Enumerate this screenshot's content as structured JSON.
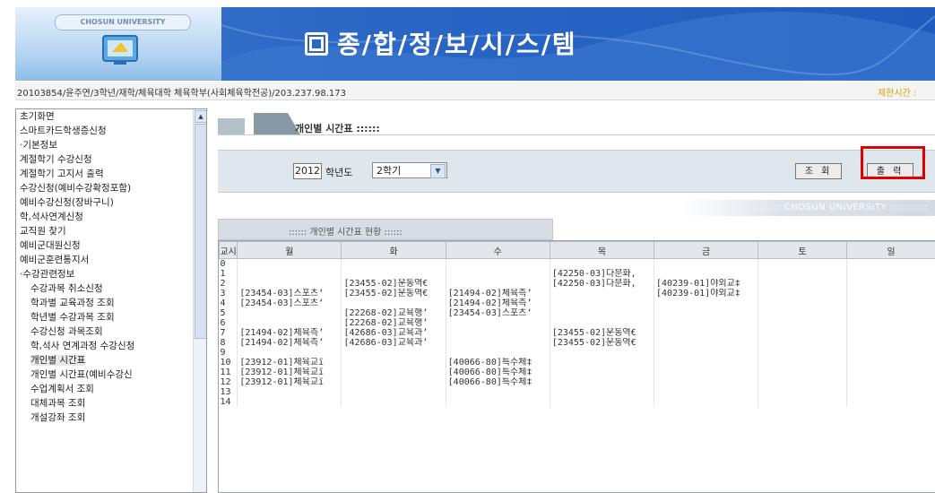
{
  "banner": {
    "university_badge": "CHOSUN UNIVERSITY",
    "system_title": "종/합/정/보/시/스/템",
    "brand_color": "#2a66c4"
  },
  "infobar": {
    "user_info": "20103854/윤주연/3학년/재학/체육대학 체육학부(사회체육학전공)/203.237.98.173",
    "right_text": "제한시간 :"
  },
  "sidebar": {
    "items": [
      {
        "label": "초기화면",
        "level": 0
      },
      {
        "label": "스마트카드학생증신청",
        "level": 0
      },
      {
        "label": "·기본정보",
        "level": 0
      },
      {
        "label": "계절학기 수강신청",
        "level": 0
      },
      {
        "label": "계절학기 고지서 출력",
        "level": 0
      },
      {
        "label": "수강신청(예비수강확정포함)",
        "level": 0
      },
      {
        "label": "예비수강신청(장바구니)",
        "level": 0
      },
      {
        "label": "학,석사연계신청",
        "level": 0
      },
      {
        "label": "교직원 찾기",
        "level": 0
      },
      {
        "label": "예비군대원신청",
        "level": 0
      },
      {
        "label": "예비군훈련통지서",
        "level": 0
      },
      {
        "label": "·수강관련정보",
        "level": 0
      },
      {
        "label": "수강과목 취소신청",
        "level": 1
      },
      {
        "label": "학과별 교육과정 조회",
        "level": 1
      },
      {
        "label": "학년별 수강과목 조회",
        "level": 1
      },
      {
        "label": "수강신청 과목조회",
        "level": 1
      },
      {
        "label": "학,석사 연계과정 수강신청",
        "level": 1
      },
      {
        "label": "개인별 시간표",
        "level": 1
      },
      {
        "label": "개인별 시간표(예비수강신",
        "level": 1
      },
      {
        "label": "수업계획서 조회",
        "level": 1
      },
      {
        "label": "대체과목 조회",
        "level": 1
      },
      {
        "label": "개설강좌 조회",
        "level": 1
      }
    ],
    "selected_index": 17
  },
  "page": {
    "title": "개인별 시간표 ::::::",
    "status_label": ":::::: 개인별 시간표 현황 ::::::",
    "university_strip": ":::::::: CHOSUN UNIVERSITY :::::::::::"
  },
  "filter": {
    "year_value": "2012",
    "year_label": "학년도",
    "semester_selected": "2학기",
    "query_button": "조 회",
    "print_button": "출 력",
    "highlight_color": "#e00000"
  },
  "timetable": {
    "headers": [
      "교시",
      "월",
      "화",
      "수",
      "목",
      "금",
      "토",
      "일"
    ],
    "rows": [
      [
        "0",
        "",
        "",
        "",
        "",
        "",
        "",
        ""
      ],
      [
        "1",
        "",
        "",
        "",
        "[42250-03]다문화,",
        "",
        "",
        ""
      ],
      [
        "2",
        "",
        "[23455-02]운동역€",
        "",
        "[42250-03]다문화,",
        "[40239-01]야외교‡",
        "",
        ""
      ],
      [
        "3",
        "[23454-03]스포츠‘",
        "[23455-02]운동역€",
        "[21494-02]체육측’",
        "",
        "[40239-01]야외교‡",
        "",
        ""
      ],
      [
        "4",
        "[23454-03]스포츠‘",
        "",
        "[21494-02]체육측’",
        "",
        "",
        "",
        ""
      ],
      [
        "5",
        "",
        "[22268-02]교육행’",
        "[23454-03]스포츠‘",
        "",
        "",
        "",
        ""
      ],
      [
        "6",
        "",
        "[22268-02]교육행’",
        "",
        "",
        "",
        "",
        ""
      ],
      [
        "7",
        "[21494-02]체육측’",
        "[42686-03]교육과’",
        "",
        "[23455-02]운동역€",
        "",
        "",
        ""
      ],
      [
        "8",
        "[21494-02]체육측’",
        "[42686-03]교육과’",
        "",
        "[23455-02]운동역€",
        "",
        "",
        ""
      ],
      [
        "9",
        "",
        "",
        "",
        "",
        "",
        "",
        ""
      ],
      [
        "10",
        "[23912-01]체육교ï",
        "",
        "[40066-80]특수체‡",
        "",
        "",
        "",
        ""
      ],
      [
        "11",
        "[23912-01]체육교ï",
        "",
        "[40066-80]특수체‡",
        "",
        "",
        "",
        ""
      ],
      [
        "12",
        "[23912-01]체육교ï",
        "",
        "[40066-80]특수체‡",
        "",
        "",
        "",
        ""
      ],
      [
        "13",
        "",
        "",
        "",
        "",
        "",
        "",
        ""
      ],
      [
        "14",
        "",
        "",
        "",
        "",
        "",
        "",
        ""
      ]
    ]
  }
}
